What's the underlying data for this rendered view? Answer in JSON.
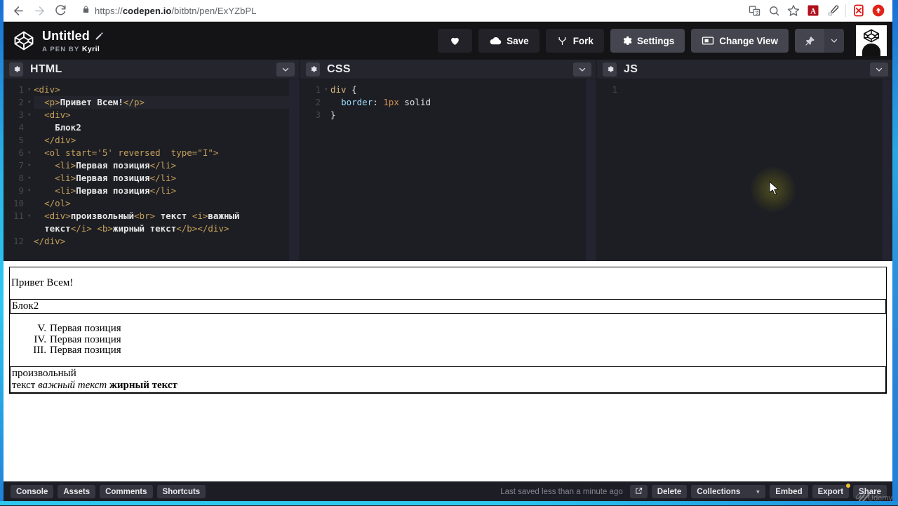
{
  "browser": {
    "back_icon": "back-arrow-icon",
    "forward_icon": "forward-arrow-icon",
    "reload_icon": "reload-icon",
    "lock_icon": "lock-icon",
    "url_prefix": "https://",
    "url_domain": "codepen.io",
    "url_path": "/bitbtn/pen/ExYZbPL",
    "extensions": [
      "translate-icon",
      "zoom-out-icon",
      "bookmark-star-icon",
      "adobe-acrobat-icon",
      "eyedropper-icon",
      "ad-blocker-icon",
      "download-manager-icon"
    ]
  },
  "header": {
    "logo_icon": "codepen-logo-icon",
    "title": "Untitled",
    "edit_icon": "pencil-icon",
    "byline_prefix": "A PEN BY",
    "byline_author": "Kyril",
    "love_label": "",
    "love_icon": "heart-icon",
    "save_label": "Save",
    "save_icon": "cloud-icon",
    "fork_label": "Fork",
    "fork_icon": "fork-icon",
    "settings_label": "Settings",
    "settings_icon": "gear-icon",
    "change_view_label": "Change View",
    "change_view_icon": "layout-icon",
    "pin_icon": "pin-icon",
    "pin_caret_icon": "chevron-down-icon",
    "avatar_icon": "user-avatar-codepen-icon"
  },
  "editors": [
    {
      "title": "HTML",
      "gear_icon": "gear-icon",
      "caret_icon": "chevron-down-icon",
      "has_scrollbar": true,
      "lines": [
        {
          "n": "1",
          "fold": "▾",
          "active": false,
          "tokens": [
            {
              "c": "tag",
              "t": "<div>"
            }
          ]
        },
        {
          "n": "2",
          "fold": "▾",
          "active": true,
          "tokens": [
            {
              "c": "plain",
              "t": "  "
            },
            {
              "c": "tag",
              "t": "<p>"
            },
            {
              "c": "txt",
              "t": "Привет Всем!"
            },
            {
              "c": "tag",
              "t": "</p>"
            }
          ]
        },
        {
          "n": "3",
          "fold": "▾",
          "active": false,
          "tokens": [
            {
              "c": "plain",
              "t": "  "
            },
            {
              "c": "tag",
              "t": "<div>"
            }
          ]
        },
        {
          "n": "4",
          "fold": "",
          "active": false,
          "tokens": [
            {
              "c": "plain",
              "t": "    "
            },
            {
              "c": "txt",
              "t": "Блок2"
            }
          ]
        },
        {
          "n": "5",
          "fold": "",
          "active": false,
          "tokens": [
            {
              "c": "plain",
              "t": "  "
            },
            {
              "c": "tag",
              "t": "</div>"
            }
          ]
        },
        {
          "n": "6",
          "fold": "▾",
          "active": false,
          "tokens": [
            {
              "c": "plain",
              "t": "  "
            },
            {
              "c": "tag",
              "t": "<ol start='5' reversed  type=\"I\">"
            }
          ]
        },
        {
          "n": "7",
          "fold": "▾",
          "active": false,
          "tokens": [
            {
              "c": "plain",
              "t": "    "
            },
            {
              "c": "tag",
              "t": "<li>"
            },
            {
              "c": "txt",
              "t": "Первая позиция"
            },
            {
              "c": "tag",
              "t": "</li>"
            }
          ]
        },
        {
          "n": "8",
          "fold": "▾",
          "active": false,
          "tokens": [
            {
              "c": "plain",
              "t": "    "
            },
            {
              "c": "tag",
              "t": "<li>"
            },
            {
              "c": "txt",
              "t": "Первая позиция"
            },
            {
              "c": "tag",
              "t": "</li>"
            }
          ]
        },
        {
          "n": "9",
          "fold": "▾",
          "active": false,
          "tokens": [
            {
              "c": "plain",
              "t": "    "
            },
            {
              "c": "tag",
              "t": "<li>"
            },
            {
              "c": "txt",
              "t": "Первая позиция"
            },
            {
              "c": "tag",
              "t": "</li>"
            }
          ]
        },
        {
          "n": "10",
          "fold": "",
          "active": false,
          "tokens": [
            {
              "c": "plain",
              "t": "  "
            },
            {
              "c": "tag",
              "t": "</ol>"
            }
          ]
        },
        {
          "n": "11",
          "fold": "▾",
          "active": false,
          "tokens": [
            {
              "c": "plain",
              "t": "  "
            },
            {
              "c": "tag",
              "t": "<div>"
            },
            {
              "c": "txt",
              "t": "произвольный"
            },
            {
              "c": "tag",
              "t": "<br>"
            },
            {
              "c": "txt",
              "t": " текст "
            },
            {
              "c": "tag",
              "t": "<i>"
            },
            {
              "c": "txt",
              "t": "важный"
            }
          ]
        },
        {
          "n": "",
          "fold": "",
          "active": false,
          "tokens": [
            {
              "c": "plain",
              "t": "  "
            },
            {
              "c": "txt",
              "t": "текст"
            },
            {
              "c": "tag",
              "t": "</i>"
            },
            {
              "c": "txt",
              "t": " "
            },
            {
              "c": "tag",
              "t": "<b>"
            },
            {
              "c": "txt",
              "t": "жирный текст"
            },
            {
              "c": "tag",
              "t": "</b></div>"
            }
          ]
        },
        {
          "n": "12",
          "fold": "",
          "active": false,
          "tokens": [
            {
              "c": "tag",
              "t": "</div>"
            }
          ]
        }
      ]
    },
    {
      "title": "CSS",
      "gear_icon": "gear-icon",
      "caret_icon": "chevron-down-icon",
      "has_scrollbar": false,
      "lines": [
        {
          "n": "1",
          "fold": "▾",
          "active": false,
          "tokens": [
            {
              "c": "sel",
              "t": "div"
            },
            {
              "c": "brace",
              "t": " {"
            }
          ]
        },
        {
          "n": "2",
          "fold": "",
          "active": false,
          "tokens": [
            {
              "c": "plain",
              "t": "  "
            },
            {
              "c": "prop",
              "t": "border"
            },
            {
              "c": "brace",
              "t": ": "
            },
            {
              "c": "num",
              "t": "1px"
            },
            {
              "c": "kw",
              "t": " solid"
            }
          ]
        },
        {
          "n": "3",
          "fold": "",
          "active": false,
          "tokens": [
            {
              "c": "brace",
              "t": "}"
            }
          ]
        }
      ]
    },
    {
      "title": "JS",
      "gear_icon": "gear-icon",
      "caret_icon": "chevron-down-icon",
      "has_scrollbar": false,
      "lines": [
        {
          "n": "1",
          "fold": "",
          "active": false,
          "tokens": []
        }
      ]
    }
  ],
  "preview": {
    "paragraph": "Привет Всем!",
    "block2": "Блок2",
    "list": [
      {
        "marker": "V.",
        "text": "Первая позиция"
      },
      {
        "marker": "IV.",
        "text": "Первая позиция"
      },
      {
        "marker": "III.",
        "text": "Первая позиция"
      }
    ],
    "free_line1": "произвольный",
    "free_prefix": "текст ",
    "free_italic": "важный текст",
    "free_space": " ",
    "free_bold": "жирный текст"
  },
  "footer": {
    "left_buttons": [
      "Console",
      "Assets",
      "Comments",
      "Shortcuts"
    ],
    "saved_text": "Last saved less than a minute ago",
    "open_icon": "external-link-icon",
    "delete_label": "Delete",
    "collections_label": "Collections",
    "collections_caret_icon": "caret-down-icon",
    "embed_label": "Embed",
    "export_label": "Export",
    "share_label": "Share",
    "watermark": "Udemy"
  },
  "cursor": {
    "icon": "mouse-pointer-icon"
  },
  "colors": {
    "header_bg": "#141417",
    "editor_bg": "#1d1e24",
    "pane_head_bg": "#25262d",
    "accent_tag": "#c5a05a",
    "frame_blue": "#2aa6e0",
    "export_dot": "#f1c232"
  }
}
